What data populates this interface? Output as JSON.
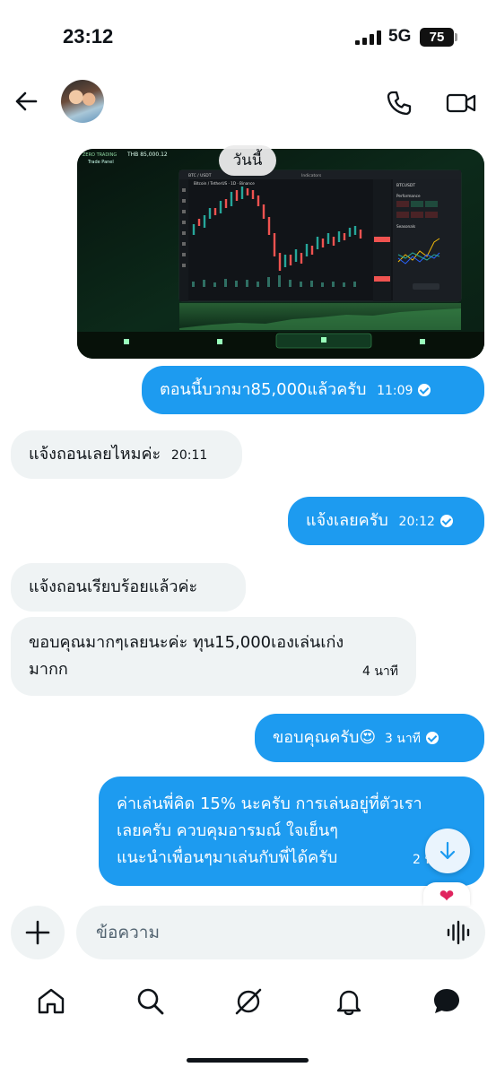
{
  "status_bar": {
    "time": "23:12",
    "network": "5G",
    "battery": "75"
  },
  "header": {
    "back_icon": "arrow-left-icon",
    "call_icon": "phone-icon",
    "video_icon": "video-camera-icon"
  },
  "chat": {
    "date_separator": "วันนี้",
    "image_message": {
      "app_title": "ZERO TRADING",
      "balance": "THB 85,000.12",
      "panel_label": "Trade Panel",
      "pair_label": "BTC / USDT",
      "symbol": "BTCUSDT",
      "header_text": "Bitcoin / TetherUS · 1D · Binance",
      "indicators_label": "Indicators",
      "performance_label": "Performance",
      "seasonals_label": "Seasonals"
    },
    "messages": [
      {
        "direction": "out",
        "text": "ตอนนี้บวกมา85,000แล้วครับ",
        "time": "11:09",
        "read": true
      },
      {
        "direction": "in",
        "text": "แจ้งถอนเลยไหมค่ะ",
        "time": "20:11"
      },
      {
        "direction": "out",
        "text": "แจ้งเลยครับ",
        "time": "20:12",
        "read": true
      },
      {
        "direction": "in",
        "text": "แจ้งถอนเรียบร้อยแล้วค่ะ",
        "time": ""
      },
      {
        "direction": "in",
        "text_lines": [
          "ขอบคุณมากๆเลยนะค่ะ ทุน15,000เองเล่นเก่ง",
          "มากก"
        ],
        "time": "4 นาที"
      },
      {
        "direction": "out",
        "text": "ขอบคุณครับ😍",
        "time": "3 นาที",
        "read": true
      },
      {
        "direction": "out",
        "text_lines": [
          "ค่าเล่นพี่คิด 15% นะครับ การเล่นอยู่ที่ตัวเรา",
          "เลยครับ ควบคุมอารมณ์ ใจเย็นๆ",
          "แนะนำเพื่อนๆมาเล่นกับพี่ได้ครับ"
        ],
        "time": "2 นาที",
        "read": true
      }
    ],
    "reaction": "❤",
    "scroll_down_icon": "arrow-down-icon"
  },
  "composer": {
    "placeholder": "ข้อความ",
    "add_icon": "plus-icon",
    "voice_icon": "voice-waveform-icon"
  },
  "bottom_nav": [
    {
      "name": "home",
      "icon": "home-icon"
    },
    {
      "name": "search",
      "icon": "search-icon"
    },
    {
      "name": "grok",
      "icon": "grok-icon"
    },
    {
      "name": "notifications",
      "icon": "bell-icon"
    },
    {
      "name": "messages",
      "icon": "chat-bubble-icon"
    }
  ],
  "colors": {
    "accent": "#1d9bf0",
    "incoming_bubble": "#eff3f4",
    "text": "#0f1419",
    "heart": "#e0245e"
  }
}
